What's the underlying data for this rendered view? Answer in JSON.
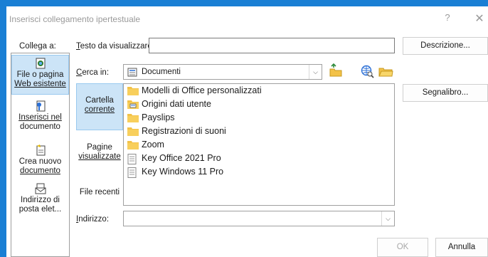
{
  "dialog": {
    "title": "Inserisci collegamento ipertestuale",
    "help_label": "?",
    "close_label": "✕"
  },
  "collega": {
    "label": "Collega a:",
    "items": [
      {
        "line1": "File o pagina",
        "line2": "Web esistente",
        "selected": true
      },
      {
        "line1": "Inserisci nel",
        "line2": "documento",
        "selected": false
      },
      {
        "line1": "Crea nuovo",
        "line2": "documento",
        "selected": false
      },
      {
        "line1": "Indirizzo di",
        "line2": "posta elet...",
        "selected": false
      }
    ]
  },
  "testo": {
    "label_first": "T",
    "label_rest": "esto da visualizzare:",
    "value": ""
  },
  "buttons": {
    "descrizione": "Descrizione...",
    "segnalibro": "Segnalibro...",
    "ok": "OK",
    "annulla": "Annulla"
  },
  "cerca": {
    "label_first": "C",
    "label_rest": "erca in:",
    "value": "Documenti"
  },
  "nav": [
    {
      "line1": "Cartella",
      "line2": "corrente",
      "selected": true
    },
    {
      "line1": "Pagine",
      "line2": "visualizzate",
      "selected": false
    },
    {
      "line1": "File recenti",
      "line2": "",
      "selected": false
    }
  ],
  "files": [
    {
      "name": "Modelli di Office personalizzati",
      "icon": "folder-icon"
    },
    {
      "name": "Origini dati utente",
      "icon": "data-source-folder-icon"
    },
    {
      "name": "Payslips",
      "icon": "folder-icon"
    },
    {
      "name": "Registrazioni di suoni",
      "icon": "folder-icon"
    },
    {
      "name": "Zoom",
      "icon": "folder-icon"
    },
    {
      "name": "Key Office 2021 Pro",
      "icon": "document-icon"
    },
    {
      "name": "Key Windows 11 Pro",
      "icon": "document-icon"
    }
  ],
  "indirizzo": {
    "label_first": "I",
    "label_rest": "ndirizzo:",
    "value": ""
  },
  "colors": {
    "window_border": "#1a7fd4",
    "selection": "#cce4f7",
    "folder": "#f3c248"
  }
}
